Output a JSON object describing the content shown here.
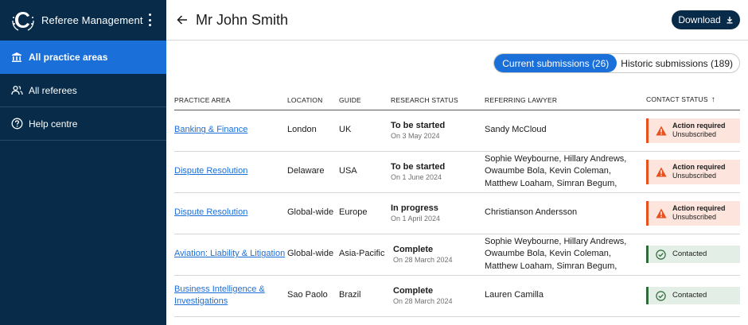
{
  "app": {
    "title": "Referee Management"
  },
  "sidebar": {
    "items": [
      {
        "label": "All practice areas",
        "icon": "bank-icon",
        "active": true
      },
      {
        "label": "All referees",
        "icon": "people-icon",
        "active": false
      },
      {
        "label": "Help centre",
        "icon": "help-icon",
        "active": false
      }
    ]
  },
  "header": {
    "title": "Mr John Smith",
    "download_label": "Download"
  },
  "submissions": {
    "current_label": "Current submissions (26)",
    "historic_label": "Historic submissions (189)"
  },
  "table": {
    "columns": [
      "PRACTICE AREA",
      "LOCATION",
      "GUIDE",
      "RESEARCH STATUS",
      "REFERRING LAWYER",
      "CONTACT STATUS"
    ],
    "sort_indicator": "↑",
    "rows": [
      {
        "practice_area": "Banking & Finance",
        "location": "London",
        "guide": "UK",
        "research_status": "To be started",
        "research_date": "On 3 May 2024",
        "lawyer": "Sandy McCloud",
        "contact_title": "Action required",
        "contact_sub": "Unsubscribed",
        "contact_type": "warning"
      },
      {
        "practice_area": "Dispute Resolution",
        "location": "Delaware",
        "guide": "USA",
        "research_status": "To be started",
        "research_date": "On 1 June 2024",
        "lawyer": "Sophie Weybourne, Hillary Andrews, Owaumbe Bola, Kevin Coleman, Matthew Loaham, Simran Begum,",
        "contact_title": "Action required",
        "contact_sub": "Unsubscribed",
        "contact_type": "warning"
      },
      {
        "practice_area": "Dispute Resolution",
        "location": "Global-wide",
        "guide": "Europe",
        "research_status": "In progress",
        "research_date": "On 1 April 2024",
        "lawyer": "Christianson Andersson",
        "contact_title": "Action required",
        "contact_sub": "Unsubscribed",
        "contact_type": "warning"
      },
      {
        "practice_area": "Aviation: Liability & Litigation",
        "location": "Global-wide",
        "guide": "Asia-Pacific",
        "research_status": "Complete",
        "research_date": "On 28 March 2024",
        "lawyer": "Sophie Weybourne, Hillary Andrews, Owaumbe Bola, Kevin Coleman, Matthew Loaham, Simran Begum,",
        "contact_title": "Contacted",
        "contact_sub": "",
        "contact_type": "success"
      },
      {
        "practice_area": "Business Intelligence & Investigations",
        "location": "Sao Paolo",
        "guide": "Brazil",
        "research_status": "Complete",
        "research_date": "On 28 March 2024",
        "lawyer": "Lauren Camilla",
        "contact_title": "Contacted",
        "contact_sub": "",
        "contact_type": "success"
      }
    ]
  },
  "colors": {
    "sidebar_bg": "#072b48",
    "accent": "#1b6fd8",
    "warning": "#e8501d",
    "warning_bg": "#fde4dc",
    "success": "#2f6b3a",
    "success_bg": "#e3efe6"
  }
}
